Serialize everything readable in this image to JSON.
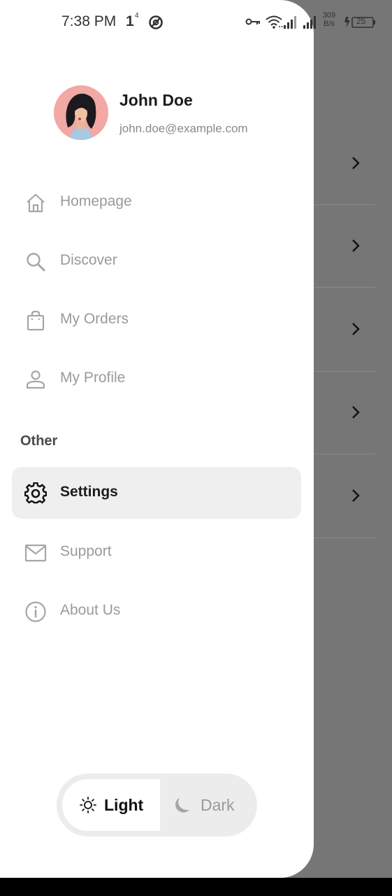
{
  "status_bar": {
    "time": "7:38 PM",
    "sim_indicator": "1",
    "sim_indicator_sup": "4",
    "net_speed_value": "309",
    "net_speed_unit": "B/s",
    "battery_level": "25",
    "icons": [
      "no-sim-icon",
      "vpn-key-icon",
      "wifi-icon",
      "signal-icon",
      "signal-icon",
      "charging-icon",
      "battery-icon"
    ]
  },
  "profile": {
    "name": "John Doe",
    "email": "john.doe@example.com"
  },
  "menu": {
    "items": [
      {
        "label": "Homepage",
        "icon": "home-icon"
      },
      {
        "label": "Discover",
        "icon": "search-icon"
      },
      {
        "label": "My Orders",
        "icon": "shopping-bag-icon"
      },
      {
        "label": "My Profile",
        "icon": "user-icon"
      }
    ],
    "section_title": "Other",
    "other_items": [
      {
        "label": "Settings",
        "icon": "gear-icon",
        "active": true
      },
      {
        "label": "Support",
        "icon": "mail-icon"
      },
      {
        "label": "About Us",
        "icon": "info-icon"
      }
    ]
  },
  "theme_toggle": {
    "light_label": "Light",
    "dark_label": "Dark",
    "selected": "Light"
  },
  "colors": {
    "accent_active_bg": "#efefef",
    "inactive_text": "#9a9a9a",
    "overlay": "#767676"
  }
}
